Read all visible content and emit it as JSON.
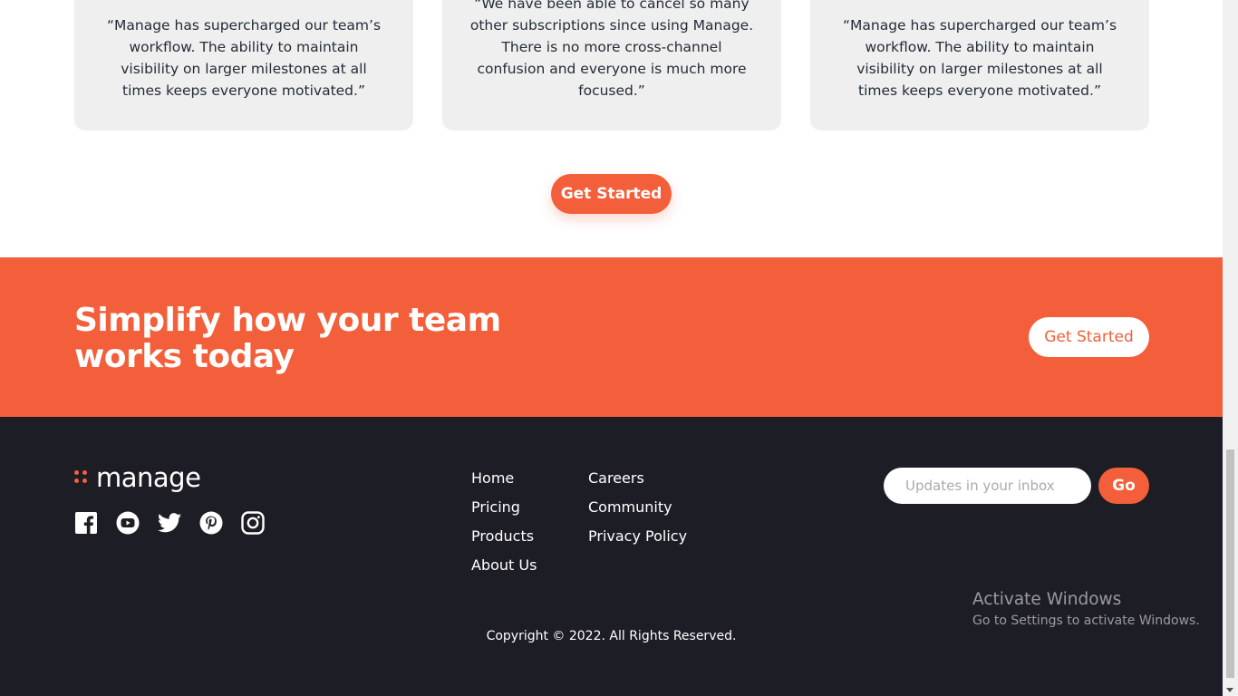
{
  "testimonials": [
    {
      "quote": "“Manage has supercharged our team’s workflow. The ability to maintain visibility on larger milestones at all times keeps everyone motivated.”"
    },
    {
      "quote": "“We have been able to cancel so many other subscriptions since using Manage. There is no more cross-channel confusion and everyone is much more focused.”"
    },
    {
      "quote": "“Manage has supercharged our team’s workflow. The ability to maintain visibility on larger milestones at all times keeps everyone motivated.”"
    }
  ],
  "testimonials_cta": {
    "label": "Get Started"
  },
  "cta_band": {
    "heading": "Simplify how your team works today",
    "button_label": "Get Started"
  },
  "footer": {
    "logo_text": "manage",
    "socials": [
      {
        "icon": "facebook-icon"
      },
      {
        "icon": "youtube-icon"
      },
      {
        "icon": "twitter-icon"
      },
      {
        "icon": "pinterest-icon"
      },
      {
        "icon": "instagram-icon"
      }
    ],
    "nav_col_1": [
      "Home",
      "Pricing",
      "Products",
      "About Us"
    ],
    "nav_col_2": [
      "Careers",
      "Community",
      "Privacy Policy"
    ],
    "newsletter": {
      "placeholder": "Updates in your inbox",
      "button_label": "Go"
    },
    "copyright": "Copyright © 2022. All Rights Reserved."
  },
  "watermark": {
    "title": "Activate Windows",
    "subtitle": "Go to Settings to activate Windows."
  },
  "colors": {
    "accent": "#f25f3a",
    "footer_bg": "#1d1e25",
    "card_bg": "#efefef"
  }
}
